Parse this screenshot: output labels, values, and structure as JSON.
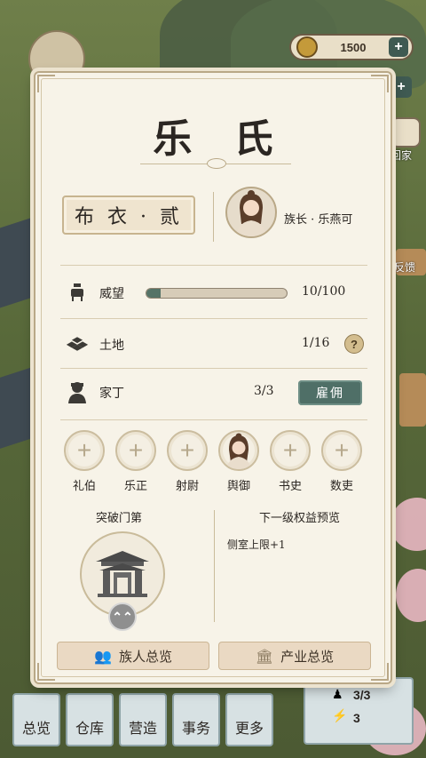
{
  "background": {
    "currency": {
      "amount": "1500",
      "icon": "coin-icon"
    },
    "side_labels": {
      "home": "回家",
      "feedback": "反馈"
    },
    "bottom_nav": [
      "总览",
      "仓库",
      "营造",
      "事务",
      "更多"
    ],
    "stats": {
      "people": "3/3",
      "energy": "3"
    }
  },
  "clan_panel": {
    "clan_name": "乐 氏",
    "rank": "布 衣 · 贰",
    "leader_label": "族长 · 乐燕可",
    "rows": {
      "prestige": {
        "label": "威望",
        "value": "10/100",
        "progress": 0.1,
        "icon": "incense-burner-icon"
      },
      "land": {
        "label": "土地",
        "value": "1/16",
        "icon": "land-tiles-icon",
        "help": "?"
      },
      "servants": {
        "label": "家丁",
        "value": "3/3",
        "icon": "servant-icon",
        "hire_label": "雇佣"
      }
    },
    "positions": [
      {
        "label": "礼伯",
        "filled": false
      },
      {
        "label": "乐正",
        "filled": false
      },
      {
        "label": "射尉",
        "filled": false
      },
      {
        "label": "舆御",
        "filled": true
      },
      {
        "label": "书史",
        "filled": false
      },
      {
        "label": "数吏",
        "filled": false
      }
    ],
    "breakthrough_title": "突破门第",
    "preview_title": "下一级权益预览",
    "benefits": [
      "侧室上限+1"
    ],
    "footer": {
      "members_label": "族人总览",
      "property_label": "产业总览"
    }
  },
  "colors": {
    "accent": "#4f6f67",
    "panel_bg": "#f7f3e8",
    "border": "#b9a887"
  }
}
